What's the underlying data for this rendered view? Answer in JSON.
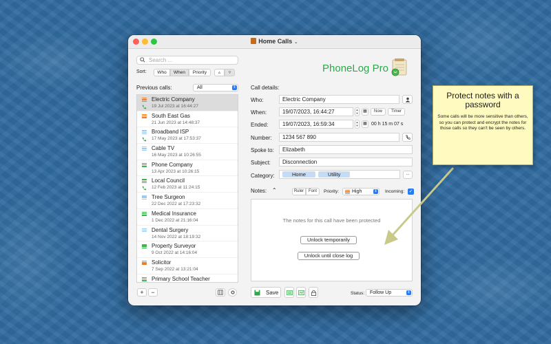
{
  "window": {
    "title": "Home Calls"
  },
  "search": {
    "placeholder": "Search ..."
  },
  "sort": {
    "label": "Sort:",
    "options": [
      "Who",
      "When",
      "Priority"
    ],
    "selected": "When",
    "asc": "▵",
    "desc": "▿"
  },
  "previous_calls": {
    "label": "Previous calls:",
    "filter": "All"
  },
  "calls": [
    {
      "name": "Electric Company",
      "date": "19 Jul 2023 at 16:44:27",
      "priority": "high",
      "incoming": true
    },
    {
      "name": "South East Gas",
      "date": "21 Jun 2023 at 14:48:37",
      "priority": "high",
      "incoming": false
    },
    {
      "name": "Broadband ISP",
      "date": "17 May 2023 at 17:53:37",
      "priority": "low",
      "incoming": true
    },
    {
      "name": "Cable TV",
      "date": "16 May 2023 at 10:26:55",
      "priority": "low",
      "incoming": false
    },
    {
      "name": "Phone Company",
      "date": "13 Apr 2023 at 10:26:15",
      "priority": "medium",
      "incoming": false
    },
    {
      "name": "Local Council",
      "date": "12 Feb 2023 at 11:24:15",
      "priority": "medium",
      "incoming": true
    },
    {
      "name": "Tree Surgeon",
      "date": "22 Dec 2022 at 17:23:32",
      "priority": "low",
      "incoming": false
    },
    {
      "name": "Medical Insurance",
      "date": "1 Dec 2022 at 21:16:04",
      "priority": "medium",
      "incoming": false
    },
    {
      "name": "Dental Surgery",
      "date": "14 Nov 2022 at 18:19:32",
      "priority": "low",
      "incoming": false
    },
    {
      "name": "Property Surveyor",
      "date": "9 Oct 2022 at 14:16:04",
      "priority": "medium",
      "incoming": false
    },
    {
      "name": "Solicitor",
      "date": "7 Sep 2022 at 13:21:04",
      "priority": "high",
      "incoming": false
    },
    {
      "name": "Primary School Teacher",
      "date": "",
      "priority": "medium",
      "incoming": false
    }
  ],
  "list_footer": {
    "add": "+",
    "remove": "−"
  },
  "app": {
    "logo_text": "PhoneLog Pro"
  },
  "details": {
    "heading": "Call details:",
    "who_label": "Who:",
    "who": "Electric Company",
    "when_label": "When:",
    "when": "19/07/2023, 16:44:27",
    "now_btn": "Now",
    "timer_btn": "Timer",
    "ended_label": "Ended:",
    "ended": "19/07/2023, 16:59:34",
    "duration": "00 h 15 m 07 s",
    "number_label": "Number:",
    "number": "1234 567 890",
    "spoke_label": "Spoke to:",
    "spoke": "Elizabeth",
    "subject_label": "Subject:",
    "subject": "Disconnection",
    "category_label": "Category:",
    "categories": [
      "Home",
      "Utility"
    ],
    "more": "..."
  },
  "notes": {
    "label": "Notes:",
    "ruler": "Ruler",
    "font": "Font",
    "priority_label": "Priority:",
    "priority": "High",
    "incoming_label": "Incoming:",
    "message": "The notes for this call have been protected",
    "unlock_temp": "Unlock temporarily",
    "unlock_close": "Unlock until close log"
  },
  "bottom": {
    "save": "Save",
    "status_label": "Status:",
    "status": "Follow Up"
  },
  "callout": {
    "title": "Protect notes with a password",
    "body": "Some calls will be more sensitive than others, so you can protect and encrypt the notes for those calls so they can't be seen by others."
  },
  "colors": {
    "accent": "#2a7af0",
    "logo": "#2aa84a",
    "high": "#f07a2c",
    "medium": "#39b54a",
    "low": "#9ec8f0",
    "callout_bg": "#fffac0"
  }
}
